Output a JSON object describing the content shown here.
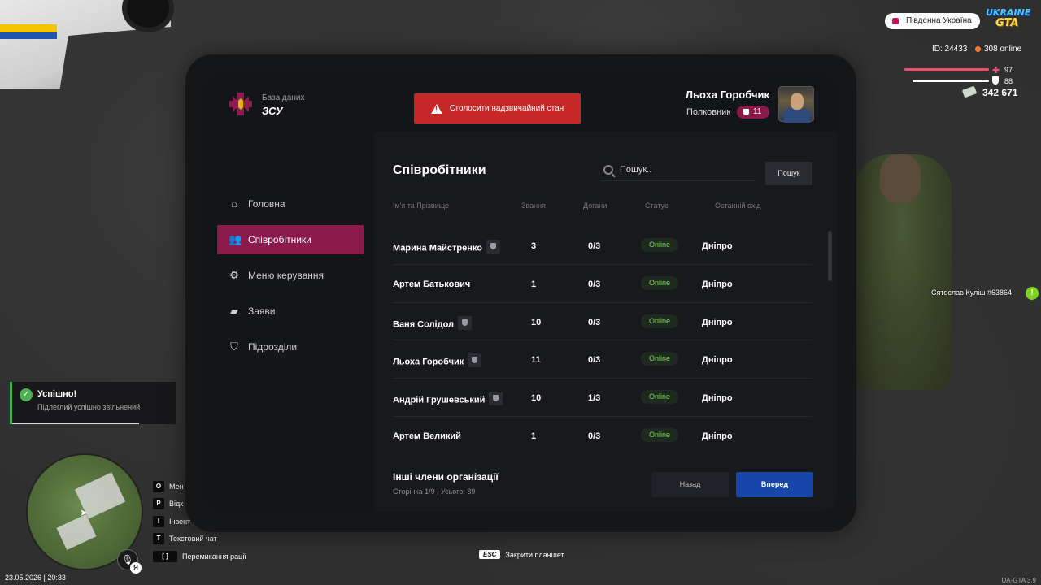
{
  "hud": {
    "region": "Південна Україна",
    "logo_top": "UKRAINE",
    "logo_bottom": "GTA",
    "player_id": "ID: 24433",
    "online": "308 online",
    "health": "97",
    "health_level": 0.97,
    "armor": "88",
    "armor_level": 0.88,
    "money": "342 671",
    "player_tag": "Сятослав Куліш #63864",
    "datetime": "23.05.2026 | 20:33",
    "version": "UA-GTA 3.9",
    "mic_badge": "Я",
    "esc_key": "ESC",
    "esc_label": "Закрити планшет",
    "keybinds": [
      {
        "key": "O",
        "label": "Мен"
      },
      {
        "key": "P",
        "label": "Відк"
      },
      {
        "key": "I",
        "label": "Інвент"
      },
      {
        "key": "T",
        "label": "Текстовий чат"
      },
      {
        "key": "[ ]",
        "label": "Перемикання рації"
      }
    ],
    "colors": {
      "health": "#f0506e",
      "armor": "#ffffff",
      "online": "#ff7a2f",
      "accent": "#8c1a4d"
    }
  },
  "toast": {
    "title": "Успішно!",
    "message": "Підлеглий успішно звільнений"
  },
  "tablet": {
    "db_label": "База даних",
    "db_name": "ЗСУ",
    "emergency_label": "Оголосити надзвичайний стан",
    "user": {
      "name": "Льоха Горобчик",
      "rank": "Полковник",
      "rank_level": "11"
    },
    "nav": [
      {
        "label": "Головна",
        "icon": "home-icon",
        "active": false
      },
      {
        "label": "Співробітники",
        "icon": "users-icon",
        "active": true
      },
      {
        "label": "Меню керування",
        "icon": "gear-icon",
        "active": false
      },
      {
        "label": "Заяви",
        "icon": "folder-icon",
        "active": false
      },
      {
        "label": "Підрозділи",
        "icon": "shield-icon",
        "active": false
      }
    ],
    "main": {
      "title": "Співробітники",
      "search_placeholder": "Пошук..",
      "search_button": "Пошук",
      "columns": [
        "Ім'я та Прізвище",
        "Звання",
        "Догани",
        "Статус",
        "Останній вхід"
      ],
      "rows": [
        {
          "name": "Марина Майстренко",
          "badge": true,
          "rank": "3",
          "warnings": "0/3",
          "status": "Online",
          "last_login": "Дніпро"
        },
        {
          "name": "Артем Батькович",
          "badge": false,
          "rank": "1",
          "warnings": "0/3",
          "status": "Online",
          "last_login": "Дніпро"
        },
        {
          "name": "Ваня Солідол",
          "badge": true,
          "rank": "10",
          "warnings": "0/3",
          "status": "Online",
          "last_login": "Дніпро"
        },
        {
          "name": "Льоха Горобчик",
          "badge": true,
          "rank": "11",
          "warnings": "0/3",
          "status": "Online",
          "last_login": "Дніпро"
        },
        {
          "name": "Андрій Грушевський",
          "badge": true,
          "rank": "10",
          "warnings": "1/3",
          "status": "Online",
          "last_login": "Дніпро"
        },
        {
          "name": "Артем Великий",
          "badge": false,
          "rank": "1",
          "warnings": "0/3",
          "status": "Online",
          "last_login": "Дніпро"
        }
      ],
      "footer_title": "Інші члени організації",
      "footer_pages": "Сторінка 1/9 | Усього: 89",
      "back_label": "Назад",
      "next_label": "Вперед"
    }
  }
}
